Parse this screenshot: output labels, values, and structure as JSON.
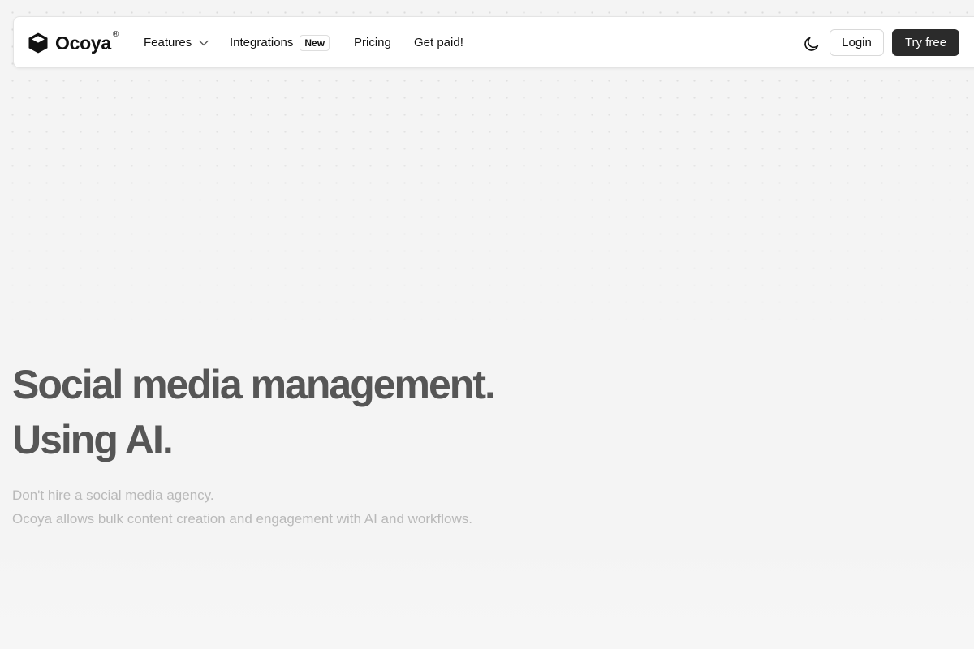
{
  "brand": {
    "name": "Ocoya",
    "registered_mark": "®",
    "icon": "cube-logo-icon"
  },
  "nav": {
    "features": "Features",
    "integrations": "Integrations",
    "integrations_badge": "New",
    "pricing": "Pricing",
    "get_paid": "Get paid!"
  },
  "actions": {
    "theme_toggle_icon": "moon-icon",
    "login": "Login",
    "try_free": "Try free"
  },
  "hero": {
    "title_line1": "Social media management.",
    "title_line2": "Using AI.",
    "subtitle_line1": "Don't hire a social media agency.",
    "subtitle_line2": "Ocoya allows bulk content creation and engagement with AI and workflows."
  },
  "colors": {
    "background": "#f4f4f4",
    "navbar": "#ffffff",
    "primary_button": "#2b2b2b",
    "title_text": "#565656",
    "subtitle_text": "#b9b9b9"
  }
}
